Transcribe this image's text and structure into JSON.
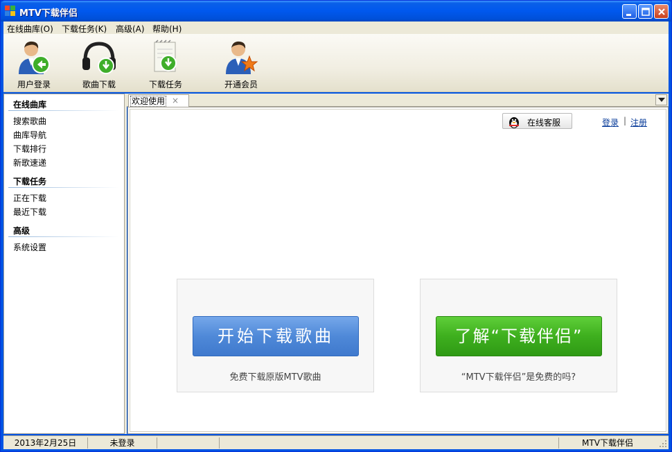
{
  "window": {
    "title": "MTV下载伴侣",
    "accent": "#0054e3"
  },
  "menu": [
    {
      "label": "在线曲库(O)"
    },
    {
      "label": "下载任务(K)"
    },
    {
      "label": "高级(A)"
    },
    {
      "label": "帮助(H)"
    }
  ],
  "toolbar": [
    {
      "label": "用户登录",
      "icon": "user-login-icon"
    },
    {
      "label": "歌曲下载",
      "icon": "headphones-download-icon"
    },
    {
      "label": "下载任务",
      "icon": "notepad-download-icon"
    },
    {
      "label": "开通会员",
      "icon": "user-star-icon"
    }
  ],
  "sidebar": {
    "sections": [
      {
        "title": "在线曲库",
        "items": [
          "搜索歌曲",
          "曲库导航",
          "下载排行",
          "新歌速递"
        ]
      },
      {
        "title": "下载任务",
        "items": [
          "正在下载",
          "最近下载"
        ]
      },
      {
        "title": "高级",
        "items": [
          "系统设置"
        ]
      }
    ]
  },
  "tabs": [
    {
      "label": "欢迎使用",
      "close": "×"
    }
  ],
  "content": {
    "support_label": "在线客服",
    "login_label": "登录",
    "separator": "|",
    "register_label": "注册",
    "cards": [
      {
        "button": "开始下载歌曲",
        "caption": "免费下载原版MTV歌曲",
        "color": "#4f89d8"
      },
      {
        "button": "了解“下载伴侣”",
        "caption": "“MTV下载伴侣”是免费的吗?",
        "color": "#3eaf1e"
      }
    ]
  },
  "status": {
    "date": "2013年2月25日",
    "login_state": "未登录",
    "app_name": "MTV下载伴侣"
  }
}
